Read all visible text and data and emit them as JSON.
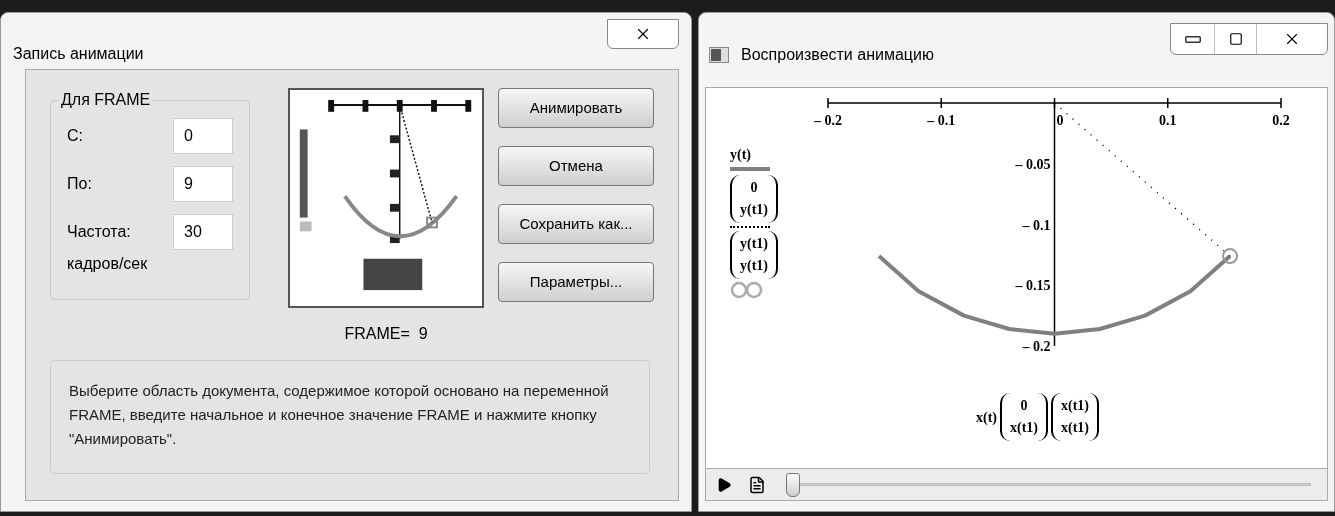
{
  "record_dialog": {
    "title": "Запись анимации",
    "group": {
      "title": "Для FRAME",
      "fields": [
        {
          "label": "С:",
          "value": "0"
        },
        {
          "label": "По:",
          "value": "9"
        },
        {
          "label": "Частота:",
          "value": "30"
        }
      ],
      "unit": "кадров/сек"
    },
    "buttons": [
      "Анимировать",
      "Отмена",
      "Сохранить как...",
      "Параметры..."
    ],
    "frame_label": "FRAME=  9",
    "hint": "Выберите область документа, содержимое которой основано на переменной FRAME, введите начальное и конечное значение FRAME и нажмите кнопку \"Анимировать\"."
  },
  "player": {
    "title": "Воспроизвести анимацию",
    "plot": {
      "y_matrices": [
        [
          "0",
          "y(t1)"
        ],
        [
          "y(t1)",
          "y(t1)"
        ]
      ],
      "x_label": "x(t)",
      "x_matrices": [
        [
          "0",
          "x(t1)"
        ],
        [
          "x(t1)",
          "x(t1)"
        ]
      ],
      "chart_data": {
        "type": "line",
        "x": [
          -0.155,
          -0.12,
          -0.08,
          -0.04,
          0,
          0.04,
          0.08,
          0.12,
          0.155
        ],
        "series": [
          {
            "name": "y(t)",
            "color": "#808080",
            "line_style": "solid",
            "values": [
              -0.126,
              -0.155,
              -0.175,
              -0.186,
              -0.19,
              -0.186,
              -0.175,
              -0.155,
              -0.126
            ]
          },
          {
            "color": "#000000",
            "line_style": "dotted",
            "values": [
              null,
              null,
              null,
              null,
              0,
              null,
              null,
              null,
              -0.126
            ]
          }
        ],
        "xlim": [
          -0.2,
          0.2
        ],
        "ylim": [
          -0.2,
          0
        ],
        "xticks": [
          {
            "value": -0.2,
            "label": "– 0.2"
          },
          {
            "value": -0.1,
            "label": "– 0.1"
          },
          {
            "value": 0,
            "label": "0"
          },
          {
            "value": 0.1,
            "label": "0.1"
          },
          {
            "value": 0.2,
            "label": "0.2"
          }
        ],
        "yticks": [
          {
            "value": -0.05,
            "label": "– 0.05"
          },
          {
            "value": -0.1,
            "label": "– 0.1"
          },
          {
            "value": -0.15,
            "label": "– 0.15"
          },
          {
            "value": -0.2,
            "label": "– 0.2"
          }
        ]
      }
    },
    "slider": {
      "level": 0
    }
  }
}
